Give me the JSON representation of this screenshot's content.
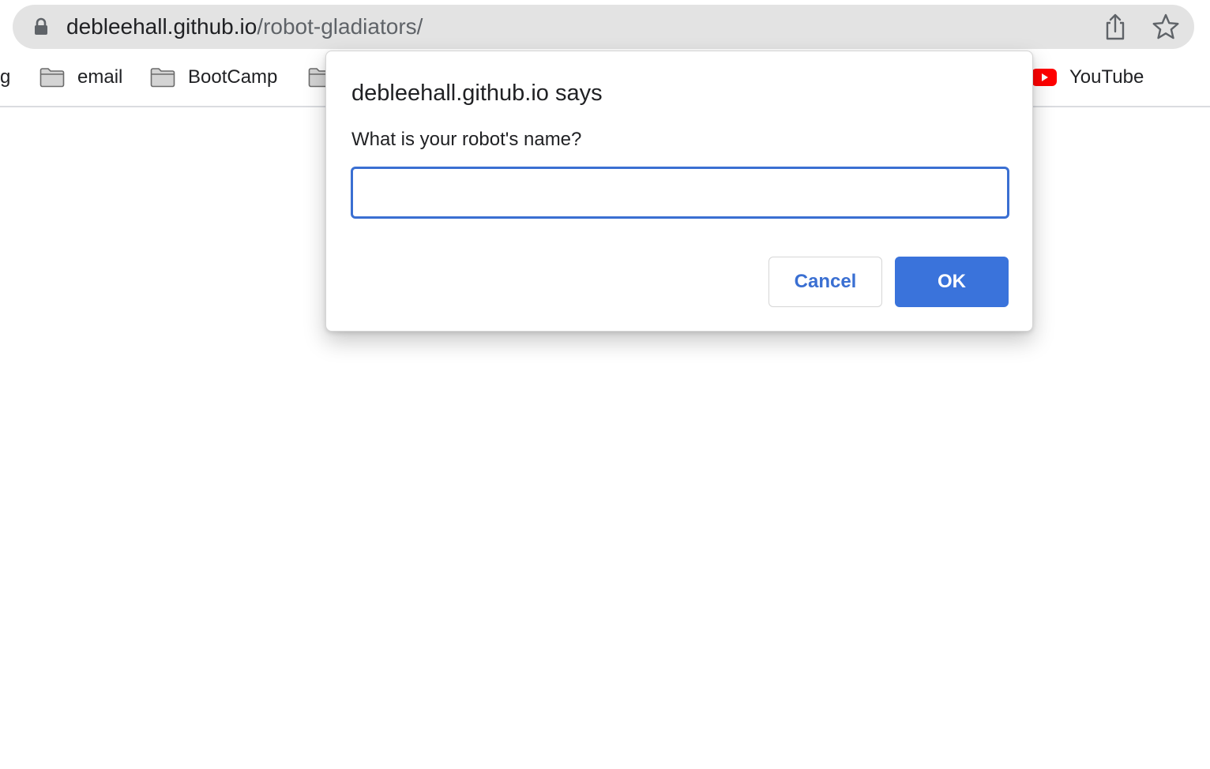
{
  "browser": {
    "url_host": "debleehall.github.io",
    "url_path": "/robot-gladiators/",
    "icons": {
      "lock": "lock-icon",
      "share": "share-icon",
      "star": "star-icon"
    }
  },
  "bookmarks": [
    {
      "label": "g",
      "icon": "none"
    },
    {
      "label": "email",
      "icon": "folder-icon"
    },
    {
      "label": "BootCamp",
      "icon": "folder-icon"
    },
    {
      "label": "",
      "icon": "folder-icon"
    },
    {
      "label": "YouTube",
      "icon": "youtube-icon"
    }
  ],
  "dialog": {
    "title": "debleehall.github.io says",
    "message": "What is your robot's name?",
    "input_value": "",
    "cancel_label": "Cancel",
    "ok_label": "OK"
  },
  "colors": {
    "accent": "#3a73db",
    "input_focus": "#3a6fd2",
    "omnibox_bg": "#e3e3e3",
    "youtube_red": "#ff0000"
  }
}
